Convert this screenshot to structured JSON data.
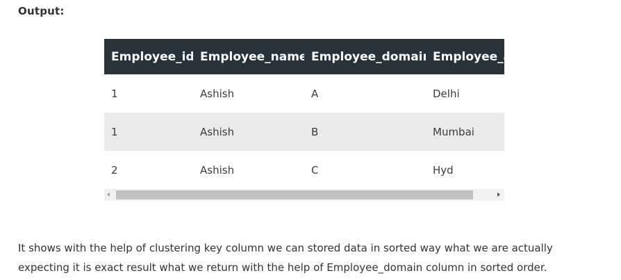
{
  "heading": "Output:",
  "table": {
    "columns": [
      "Employee_id",
      "Employee_name",
      "Employee_domain",
      "Employee_address"
    ],
    "rows": [
      [
        "1",
        "Ashish",
        "A",
        "Delhi"
      ],
      [
        "1",
        "Ashish",
        "B",
        "Mumbai"
      ],
      [
        "2",
        "Ashish",
        "C",
        "Hyd"
      ]
    ]
  },
  "paragraph": {
    "line1": "It shows with the help of clustering key column we can stored data in sorted way what we are actually",
    "line2": "expecting it is exact result what we return with the help of Employee_domain column in sorted order."
  },
  "colors": {
    "header_bg": "#283238",
    "alt_row_bg": "#eaeaea",
    "scroll_thumb": "#c1c1c1"
  }
}
